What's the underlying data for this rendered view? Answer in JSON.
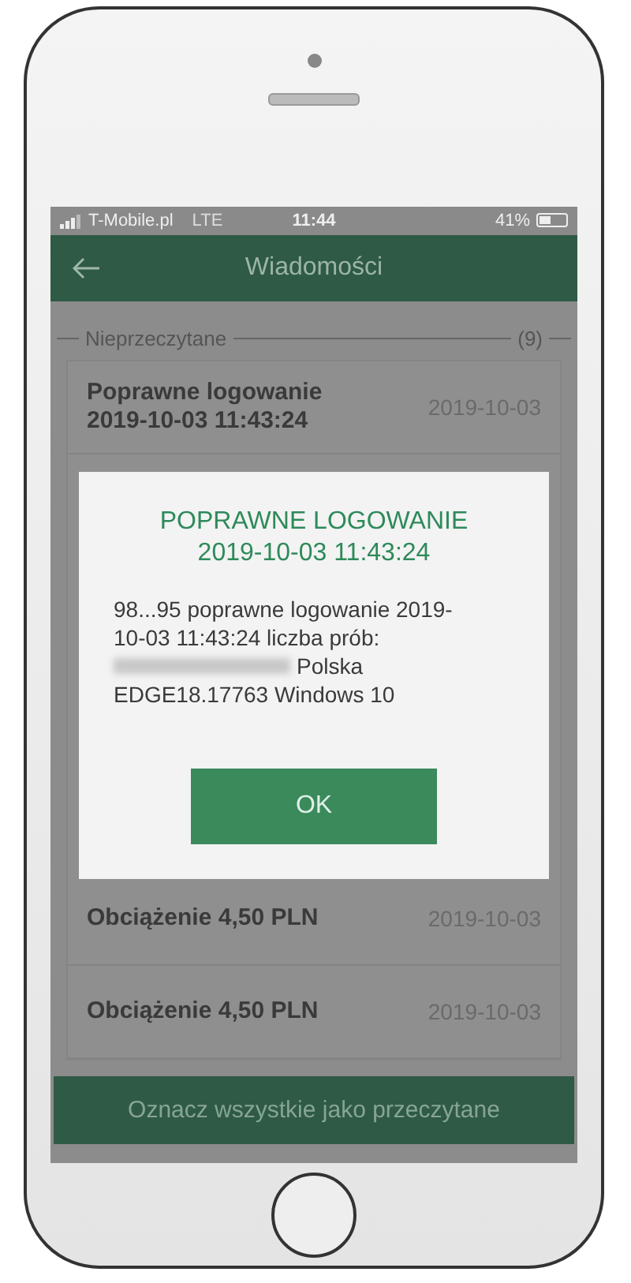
{
  "status_bar": {
    "carrier": "T-Mobile.pl",
    "network": "LTE",
    "time": "11:44",
    "battery": "41%"
  },
  "header": {
    "title": "Wiadomości"
  },
  "section": {
    "label": "Nieprzeczytane",
    "count": "(9)"
  },
  "messages_above_dialog": [
    {
      "title": "Poprawne logowanie 2019-10-03 11:43:24",
      "date": "2019-10-03"
    }
  ],
  "messages_below_dialog": [
    {
      "title": "Obciążenie 4,50 PLN",
      "date": "2019-10-03"
    },
    {
      "title": "Obciążenie 4,50 PLN",
      "date": "2019-10-03"
    }
  ],
  "dialog": {
    "title": "POPRAWNE LOGOWANIE 2019-10-03 11:43:24",
    "body": "98...95 poprawne logowanie 2019-10-03 11:43:24 liczba prób:",
    "location": "Polska",
    "browser": "EDGE18.17763 Windows 10",
    "button": "OK"
  },
  "footer_button": "Oznacz wszystkie jako przeczytane"
}
